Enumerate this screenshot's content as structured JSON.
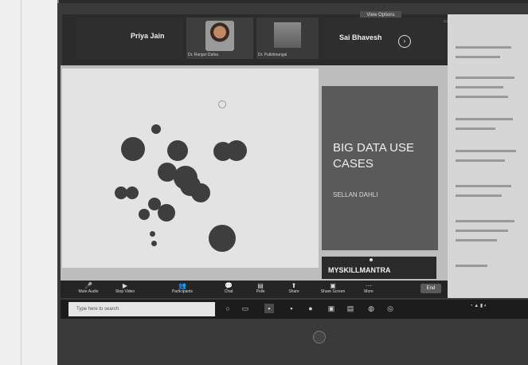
{
  "meeting": {
    "view_options": "View Options",
    "participants": [
      {
        "name": "Priya Jain",
        "sub": ""
      },
      {
        "name": "",
        "sub": "Dr. Ranjan Dahia"
      },
      {
        "name": "",
        "sub": "Dr. Pulkitmangal"
      },
      {
        "name": "Sai Bhavesh",
        "sub": ""
      }
    ]
  },
  "slide": {
    "title": "BIG DATA USE CASES",
    "subtitle": "SELLAN DAHLI",
    "brand": "MYSKILLMANTRA"
  },
  "toolbar": {
    "items": [
      {
        "icon": "mic-icon",
        "glyph": "🎤",
        "label": "Mute Audio"
      },
      {
        "icon": "video-icon",
        "glyph": "▶",
        "label": "Stop Video"
      },
      {
        "icon": "participants-icon",
        "glyph": "👥",
        "label": "Participants"
      },
      {
        "icon": "chat-icon",
        "glyph": "💬",
        "label": "Chat"
      },
      {
        "icon": "polls-icon",
        "glyph": "▤",
        "label": "Polls"
      },
      {
        "icon": "share-icon",
        "glyph": "⬆",
        "label": "Share"
      },
      {
        "icon": "share-screen-icon",
        "glyph": "▣",
        "label": "Share Screen"
      },
      {
        "icon": "more-icon",
        "glyph": "⋯",
        "label": "More"
      }
    ],
    "end": "End"
  },
  "taskbar": {
    "search_placeholder": "Type here to search"
  }
}
